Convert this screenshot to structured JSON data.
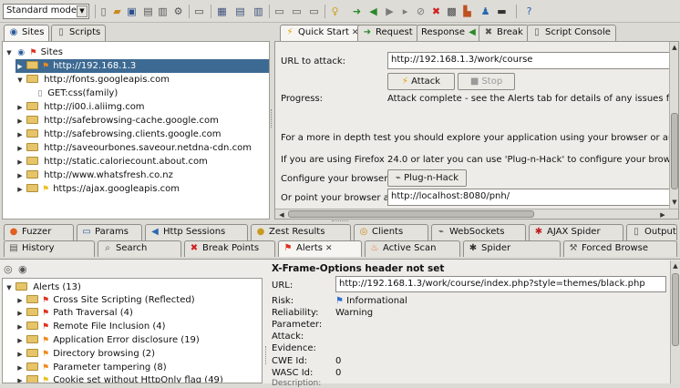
{
  "toolbar": {
    "mode": "Standard mode",
    "icons": [
      "new-session-icon",
      "open-session-icon",
      "save-session-icon",
      "snapshot-icon",
      "session-properties-icon",
      "options-icon",
      "layout-icon",
      "panel-layout-1-icon",
      "panel-layout-2-icon",
      "panel-layout-3-icon",
      "tab-layout-1-icon",
      "tab-layout-2-icon",
      "tab-layout-3-icon",
      "lightbulb-icon",
      "forward-arrow-icon",
      "back-arrow-icon",
      "step-icon",
      "play-icon",
      "stop-icon",
      "break-delete-icon",
      "scan-policy-icon",
      "active-scan-icon",
      "user-icon",
      "terminal-icon",
      "help-icon"
    ]
  },
  "left_tabs": {
    "sites": "Sites",
    "scripts": "Scripts"
  },
  "sites": {
    "root": "Sites",
    "items": [
      {
        "label": "http://192.168.1.3",
        "selected": true
      },
      {
        "label": "http://fonts.googleapis.com",
        "expanded": true
      },
      {
        "label": "GET:css(family)"
      },
      {
        "label": "http://i00.i.aliimg.com"
      },
      {
        "label": "http://safebrowsing-cache.google.com"
      },
      {
        "label": "http://safebrowsing.clients.google.com"
      },
      {
        "label": "http://saveourbones.saveour.netdna-cdn.com"
      },
      {
        "label": "http://static.caloriecount.about.com"
      },
      {
        "label": "http://www.whatsfresh.co.nz"
      },
      {
        "label": "https://ajax.googleapis.com"
      }
    ]
  },
  "right_tabs": {
    "quick_start": "Quick Start",
    "request": "Request",
    "response": "Response",
    "break": "Break",
    "script_console": "Script Console"
  },
  "quick_start": {
    "url_label": "URL to attack:",
    "url_value": "http://192.168.1.3/work/course",
    "attack_button": "Attack",
    "stop_button": "Stop",
    "progress_label": "Progress:",
    "progress_value": "Attack complete - see the Alerts tab for details of any issues found",
    "depth_text": "For a more in depth test you should explore your application using your browser or automated",
    "firefox_text": "If you are using Firefox 24.0 or later you can use 'Plug-n-Hack' to configure your browser:",
    "configure_label": "Configure your browser:",
    "pnh_button": "Plug-n-Hack",
    "point_label": "Or point your browser at:",
    "point_value": "http://localhost:8080/pnh/"
  },
  "bottom_tabs_row1": [
    "Fuzzer",
    "Params",
    "Http Sessions",
    "Zest Results",
    "Clients",
    "WebSockets",
    "AJAX Spider",
    "Output"
  ],
  "bottom_tabs_row2": [
    "History",
    "Search",
    "Break Points",
    "Alerts",
    "Active Scan",
    "Spider",
    "Forced Browse"
  ],
  "alerts": {
    "root": "Alerts (13)",
    "items": [
      {
        "label": "Cross Site Scripting (Reflected)",
        "risk": "high"
      },
      {
        "label": "Path Traversal (4)",
        "risk": "high"
      },
      {
        "label": "Remote File Inclusion (4)",
        "risk": "high"
      },
      {
        "label": "Application Error disclosure (19)",
        "risk": "medium"
      },
      {
        "label": "Directory browsing (2)",
        "risk": "medium"
      },
      {
        "label": "Parameter tampering (8)",
        "risk": "medium"
      },
      {
        "label": "Cookie set without HttpOnly flag (49)",
        "risk": "low"
      }
    ]
  },
  "alert_detail": {
    "title": "X-Frame-Options header not set",
    "url_label": "URL:",
    "url_value": "http://192.168.1.3/work/course/index.php?style=themes/black.php",
    "risk_label": "Risk:",
    "risk_value": "Informational",
    "reliability_label": "Reliability:",
    "reliability_value": "Warning",
    "parameter_label": "Parameter:",
    "attack_label": "Attack:",
    "evidence_label": "Evidence:",
    "cwe_label": "CWE Id:",
    "cwe_value": "0",
    "wasc_label": "WASC Id:",
    "wasc_value": "0",
    "description_label": "Description:"
  },
  "colors": {
    "selection": "#3d6a92",
    "risk_high": "#e0301e",
    "risk_medium": "#f08a1c",
    "risk_low": "#e8c020",
    "risk_info": "#2f6fd1"
  }
}
